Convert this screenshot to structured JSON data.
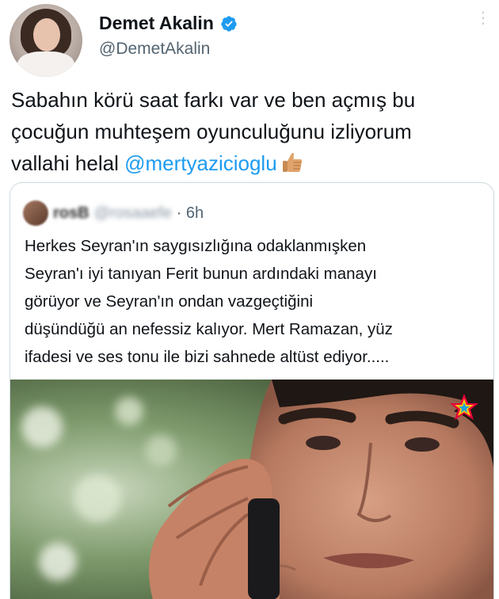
{
  "author": {
    "display_name": "Demet Akalin",
    "handle": "@DemetAkalin",
    "verified": true,
    "avatar_icon": "profile-photo"
  },
  "tweet": {
    "text_lines": [
      "Sabahın körü saat farkı var ve ben açmış bu",
      "çocuğun muhteşem oyunculuğunu izliyorum",
      "vallahi helal "
    ],
    "mention": "@mertyazicioglu",
    "emoji_icon": "thumbs-up-icon"
  },
  "quoted_tweet": {
    "name": "rosB",
    "handle": "@rosaaefe",
    "time": "· 6h",
    "text_lines": [
      "Herkes Seyran'ın saygısızlığına odaklanmışken",
      "Seyran'ı iyi tanıyan Ferit bunun ardındaki manayı",
      "görüyor ve Seyran'ın ondan vazgeçtiğini",
      "düşündüğü an nefessiz kalıyor. Mert Ramazan, yüz",
      "ifadesi ve ses tonu ile bizi sahnede altüst ediyor....."
    ],
    "media": {
      "description_icon": "video-still",
      "channel_logo_icon": "star-channel-logo-icon"
    }
  },
  "colors": {
    "accent": "#1d9bf0",
    "text": "#0f1419",
    "secondary": "#536471",
    "border": "#cfd9de"
  }
}
